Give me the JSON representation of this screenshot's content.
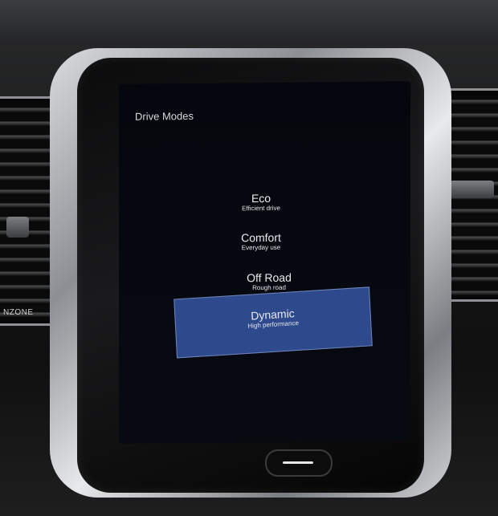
{
  "screen": {
    "title": "Drive Modes",
    "modes": [
      {
        "name": "Eco",
        "description": "Efficient drive",
        "selected": false
      },
      {
        "name": "Comfort",
        "description": "Everyday use",
        "selected": false
      },
      {
        "name": "Off Road",
        "description": "Rough road",
        "selected": false
      },
      {
        "name": "Dynamic",
        "description": "High performance",
        "selected": true
      }
    ],
    "selected_color": "#2e4a8d"
  },
  "dashboard": {
    "zone_label": "NZONE"
  }
}
